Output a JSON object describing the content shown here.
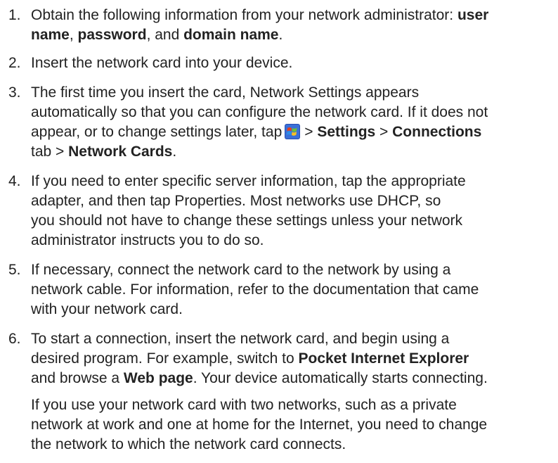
{
  "steps": [
    {
      "number": "1.",
      "l1_a": "Obtain the following information from your network administrator: ",
      "l1_b": "user",
      "l2_a": "name",
      "l2_b": ", ",
      "l2_c": "password",
      "l2_d": ", and ",
      "l2_e": "domain name",
      "l2_f": "."
    },
    {
      "number": "2.",
      "text": "Insert the network card into your device."
    },
    {
      "number": "3.",
      "l1": "The first time you insert the card, Network Settings appears",
      "l2": "automatically so that you can configure the network card. If it does not",
      "l3_a": "appear, or to change settings later, tap",
      "l3_sep1": "> ",
      "l3_b": "Settings",
      "l3_sep2": " > ",
      "l3_c": "Connections",
      "l4_a": "tab > ",
      "l4_b": "Network Cards",
      "l4_c": "."
    },
    {
      "number": "4.",
      "l1": "If you need to enter specific server information, tap the appropriate",
      "l2": "adapter, and then tap Properties. Most networks use DHCP, so",
      "l3": "you should not have to change these settings unless your network",
      "l4": "administrator instructs you to do so."
    },
    {
      "number": "5.",
      "l1": "If necessary, connect the network card to the network by using a",
      "l2": "network cable. For information, refer to the documentation that came",
      "l3": "with your network card."
    },
    {
      "number": "6.",
      "l1": "To start a connection, insert the network card, and begin using a",
      "l2_a": "desired program. For example, switch to ",
      "l2_b": "Pocket Internet Explorer",
      "l3_a": "and browse a ",
      "l3_b": "Web page",
      "l3_c": ". Your device automatically starts connecting.",
      "p2_l1": "If you use your network card with two networks, such as a private",
      "p2_l2": "network at work and one at home for the Internet, you need to change",
      "p2_l3": "the network to which the network card connects."
    }
  ],
  "icons": {
    "start_icon": "windows-start-flag-icon"
  }
}
